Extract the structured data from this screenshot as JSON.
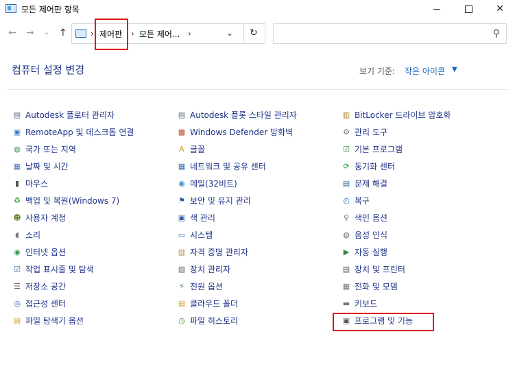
{
  "window": {
    "title": "모든 제어판 항목",
    "minimize_glyph": "",
    "maximize_glyph": "",
    "close_glyph": "✕"
  },
  "nav": {
    "back_glyph": "←",
    "forward_glyph": "→",
    "recent_glyph": "⌄",
    "up_glyph": "↑"
  },
  "address": {
    "separator": "›",
    "crumbs": [
      "제어판",
      "모든 제어..."
    ],
    "dropdown_glyph": "⌄",
    "refresh_glyph": "↻"
  },
  "search": {
    "placeholder": "",
    "icon": "search-icon",
    "icon_glyph": "⚲"
  },
  "header": {
    "title": "컴퓨터 설정 변경",
    "view_label": "보기 기준:",
    "view_value": "작은 아이콘",
    "view_caret": "▼"
  },
  "items": {
    "col1": [
      {
        "label": "Autodesk 플로터 관리자",
        "icon": "printer-icon",
        "glyph": "▤",
        "color": "#5a6c8a"
      },
      {
        "label": "RemoteApp 및 데스크톱 연결",
        "icon": "remote-desktop-icon",
        "glyph": "▣",
        "color": "#3c7cc3"
      },
      {
        "label": "국가 또는 지역",
        "icon": "globe-icon",
        "glyph": "◍",
        "color": "#2f8f4e"
      },
      {
        "label": "날짜 및 시간",
        "icon": "calendar-clock-icon",
        "glyph": "▦",
        "color": "#4a7bb7"
      },
      {
        "label": "마우스",
        "icon": "mouse-icon",
        "glyph": "▮",
        "color": "#555555"
      },
      {
        "label": "백업 및 복원(Windows 7)",
        "icon": "backup-icon",
        "glyph": "♻",
        "color": "#2d9a3a"
      },
      {
        "label": "사용자 계정",
        "icon": "users-icon",
        "glyph": "☻",
        "color": "#6a8a3a"
      },
      {
        "label": "소리",
        "icon": "speaker-icon",
        "glyph": "◖",
        "color": "#777777"
      },
      {
        "label": "인터넷 옵션",
        "icon": "internet-globe-icon",
        "glyph": "◉",
        "color": "#2a9a4a"
      },
      {
        "label": "작업 표시줄 및 탐색",
        "icon": "taskbar-icon",
        "glyph": "☑",
        "color": "#3f6fa8"
      },
      {
        "label": "저장소 공간",
        "icon": "storage-icon",
        "glyph": "☰",
        "color": "#666666"
      },
      {
        "label": "접근성 센터",
        "icon": "accessibility-icon",
        "glyph": "◎",
        "color": "#2f65b5"
      },
      {
        "label": "파일 탐색기 옵션",
        "icon": "folder-options-icon",
        "glyph": "▤",
        "color": "#d6a531"
      }
    ],
    "col2": [
      {
        "label": "Autodesk 플롯 스타일 관리자",
        "icon": "printer-style-icon",
        "glyph": "▤",
        "color": "#5a6c8a"
      },
      {
        "label": "Windows Defender 방화벽",
        "icon": "firewall-icon",
        "glyph": "▩",
        "color": "#b4552d"
      },
      {
        "label": "글꼴",
        "icon": "font-icon",
        "glyph": "A",
        "color": "#c99a1e"
      },
      {
        "label": "네트워크 및 공유 센터",
        "icon": "network-icon",
        "glyph": "▦",
        "color": "#3b6db0"
      },
      {
        "label": "메일(32비트)",
        "icon": "mail-icon",
        "glyph": "◉",
        "color": "#3a8fd0"
      },
      {
        "label": "보안 및 유지 관리",
        "icon": "flag-icon",
        "glyph": "⚑",
        "color": "#2c5ea8"
      },
      {
        "label": "색 관리",
        "icon": "color-monitor-icon",
        "glyph": "▣",
        "color": "#3a5fa0"
      },
      {
        "label": "시스템",
        "icon": "system-monitor-icon",
        "glyph": "▭",
        "color": "#3d77c0"
      },
      {
        "label": "자격 증명 관리자",
        "icon": "credential-vault-icon",
        "glyph": "▥",
        "color": "#b08a3a"
      },
      {
        "label": "장치 관리자",
        "icon": "device-manager-icon",
        "glyph": "▧",
        "color": "#666666"
      },
      {
        "label": "전원 옵션",
        "icon": "power-icon",
        "glyph": "⚡",
        "color": "#3a8a3a"
      },
      {
        "label": "클라우드 폴더",
        "icon": "cloud-folder-icon",
        "glyph": "▤",
        "color": "#d1a02c"
      },
      {
        "label": "파일 히스토리",
        "icon": "file-history-icon",
        "glyph": "◷",
        "color": "#4a9a3a"
      }
    ],
    "col3": [
      {
        "label": "BitLocker 드라이브 암호화",
        "icon": "bitlocker-icon",
        "glyph": "▥",
        "color": "#a8842e"
      },
      {
        "label": "관리 도구",
        "icon": "admin-tools-icon",
        "glyph": "⚙",
        "color": "#777777"
      },
      {
        "label": "기본 프로그램",
        "icon": "default-programs-icon",
        "glyph": "☑",
        "color": "#2d8a3a"
      },
      {
        "label": "동기화 센터",
        "icon": "sync-icon",
        "glyph": "⟳",
        "color": "#2e9a3a"
      },
      {
        "label": "문제 해결",
        "icon": "troubleshoot-icon",
        "glyph": "▤",
        "color": "#3a6ab0"
      },
      {
        "label": "복구",
        "icon": "recovery-icon",
        "glyph": "◴",
        "color": "#2a78c0"
      },
      {
        "label": "색인 옵션",
        "icon": "indexing-icon",
        "glyph": "⚲",
        "color": "#777777"
      },
      {
        "label": "음성 인식",
        "icon": "microphone-icon",
        "glyph": "◍",
        "color": "#666666"
      },
      {
        "label": "자동 실행",
        "icon": "autoplay-icon",
        "glyph": "▶",
        "color": "#2f8a3a"
      },
      {
        "label": "장치 및 프린터",
        "icon": "devices-printers-icon",
        "glyph": "▤",
        "color": "#555555"
      },
      {
        "label": "전화 및 모뎀",
        "icon": "phone-modem-icon",
        "glyph": "▦",
        "color": "#777777"
      },
      {
        "label": "키보드",
        "icon": "keyboard-icon",
        "glyph": "▬",
        "color": "#777777"
      },
      {
        "label": "프로그램 및 기능",
        "icon": "programs-features-icon",
        "glyph": "▣",
        "color": "#555555"
      }
    ]
  },
  "colors": {
    "link": "#1e3287",
    "highlight": "#e01616",
    "view_value": "#1666b8"
  }
}
